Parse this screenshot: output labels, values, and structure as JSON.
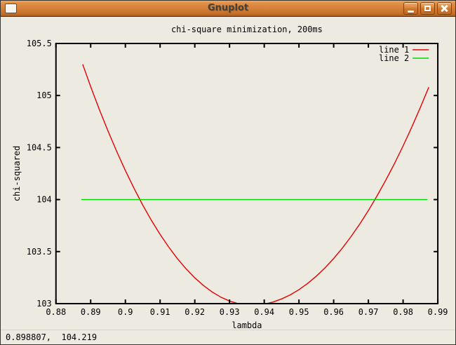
{
  "window": {
    "title": "Gnuplot",
    "icons": {
      "window_menu": "window-icon",
      "minimize": "minimize-icon",
      "maximize": "maximize-icon",
      "close": "close-icon"
    }
  },
  "statusbar": {
    "coordinates": "0.898807,  104.219"
  },
  "theme": {
    "titlebar_orange": "#d5813a",
    "canvas_background": "#edeae2",
    "axis_color": "#000000"
  },
  "chart_data": {
    "type": "line",
    "title": "chi-square minimization, 200ms",
    "xlabel": "lambda",
    "ylabel": "chi-squared",
    "xlim": [
      0.88,
      0.99
    ],
    "ylim": [
      103.0,
      105.5
    ],
    "grid": false,
    "legend_position": "top-right-inside",
    "x_tick_labels": [
      "0.88",
      "0.89",
      "0.9",
      "0.91",
      "0.92",
      "0.93",
      "0.94",
      "0.95",
      "0.96",
      "0.97",
      "0.98",
      "0.99"
    ],
    "y_tick_labels": [
      "103",
      "103.5",
      "104",
      "104.5",
      "105",
      "105.5"
    ],
    "series": [
      {
        "name": "line 1",
        "color": "#e60000",
        "points": [
          [
            0.8877,
            105.3
          ],
          [
            0.89,
            105.086
          ],
          [
            0.8925,
            104.866
          ],
          [
            0.895,
            104.658
          ],
          [
            0.8975,
            104.462
          ],
          [
            0.9,
            104.278
          ],
          [
            0.9025,
            104.107
          ],
          [
            0.905,
            103.947
          ],
          [
            0.9075,
            103.8
          ],
          [
            0.91,
            103.665
          ],
          [
            0.9125,
            103.543
          ],
          [
            0.915,
            103.432
          ],
          [
            0.9175,
            103.334
          ],
          [
            0.92,
            103.248
          ],
          [
            0.9225,
            103.174
          ],
          [
            0.925,
            103.112
          ],
          [
            0.9275,
            103.062
          ],
          [
            0.93,
            103.025
          ],
          [
            0.9325,
            103.0
          ],
          [
            0.935,
            102.987
          ],
          [
            0.9364,
            102.985
          ],
          [
            0.94,
            102.995
          ],
          [
            0.9425,
            103.015
          ],
          [
            0.945,
            103.045
          ],
          [
            0.9475,
            103.084
          ],
          [
            0.95,
            103.134
          ],
          [
            0.9525,
            103.194
          ],
          [
            0.955,
            103.264
          ],
          [
            0.9575,
            103.344
          ],
          [
            0.96,
            103.434
          ],
          [
            0.9625,
            103.534
          ],
          [
            0.965,
            103.644
          ],
          [
            0.9675,
            103.764
          ],
          [
            0.97,
            103.894
          ],
          [
            0.9725,
            104.035
          ],
          [
            0.975,
            104.185
          ],
          [
            0.9775,
            104.346
          ],
          [
            0.98,
            104.516
          ],
          [
            0.9825,
            104.697
          ],
          [
            0.985,
            104.888
          ],
          [
            0.9874,
            105.08
          ]
        ]
      },
      {
        "name": "line 2",
        "color": "#00d800",
        "points": [
          [
            0.8873,
            104.0
          ],
          [
            0.987,
            104.0
          ]
        ]
      }
    ]
  }
}
